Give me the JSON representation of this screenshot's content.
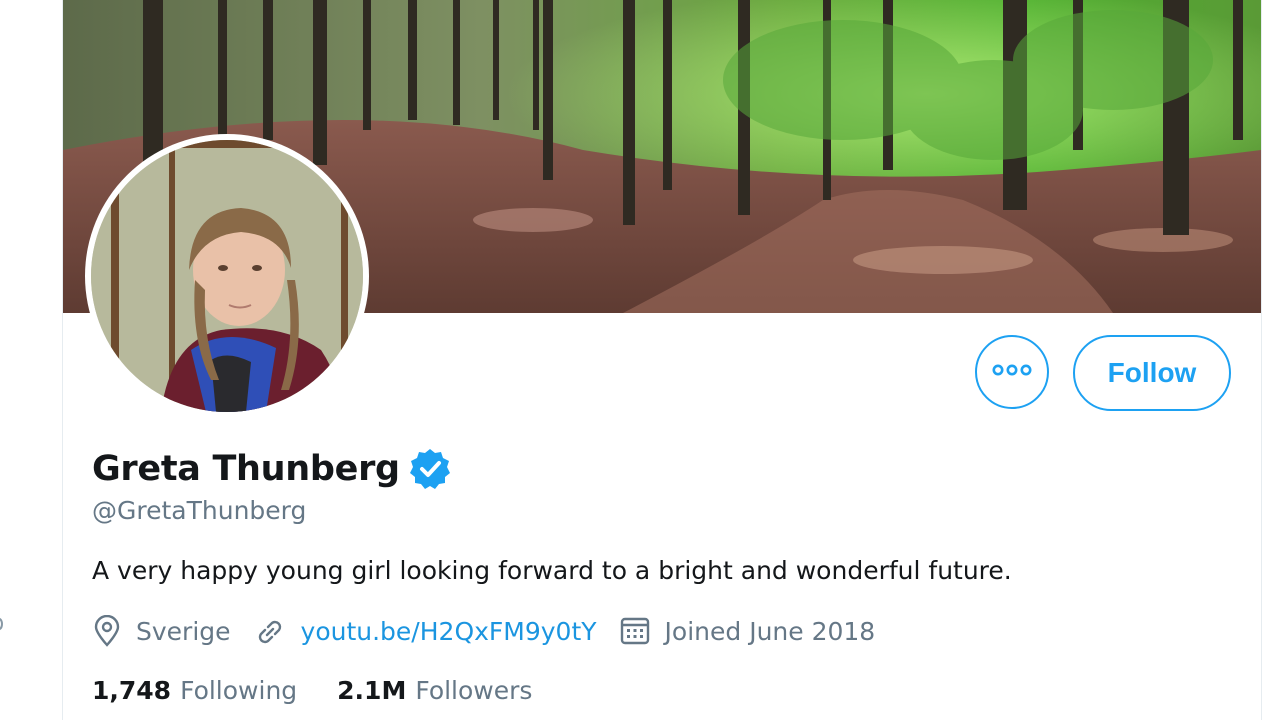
{
  "profile": {
    "display_name": "Greta Thunberg",
    "handle": "@GretaThunberg",
    "verified": true,
    "bio": "A very happy young girl looking forward to a bright and wonderful future.",
    "location": "Sverige",
    "website": "youtu.be/H2QxFM9y0tY",
    "joined": "Joined June 2018",
    "following_count": "1,748",
    "following_label": "Following",
    "followers_count": "2.1M",
    "followers_label": "Followers"
  },
  "actions": {
    "follow_label": "Follow",
    "more_icon": "more-horizontal-icon"
  },
  "icons": {
    "location": "location-pin-icon",
    "website": "link-icon",
    "joined": "calendar-icon",
    "verified": "verified-badge-icon"
  },
  "colors": {
    "accent": "#1da1f2",
    "link": "#1b95e0",
    "text_primary": "#14171a",
    "text_secondary": "#657786"
  }
}
